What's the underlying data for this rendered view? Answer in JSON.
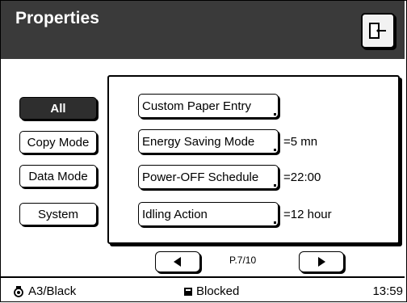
{
  "header": {
    "title": "Properties"
  },
  "categories": [
    {
      "label": "All"
    },
    {
      "label": "Copy Mode"
    },
    {
      "label": "Data Mode"
    },
    {
      "label": "System"
    }
  ],
  "settings": [
    {
      "label": "Custom Paper Entry",
      "value": ""
    },
    {
      "label": "Energy Saving Mode",
      "value": "=5 mn"
    },
    {
      "label": "Power-OFF Schedule",
      "value": "=22:00"
    },
    {
      "label": "Idling Action",
      "value": "=12 hour"
    }
  ],
  "pager": {
    "indicator": "P.7/10"
  },
  "status": {
    "paper": "A3/Black",
    "state": "Blocked",
    "time": "13:59"
  },
  "icons": {
    "exit": "exit-door-icon",
    "prev": "triangle-left-icon",
    "next": "triangle-right-icon",
    "paper": "toner-icon",
    "blocked": "square-icon"
  }
}
